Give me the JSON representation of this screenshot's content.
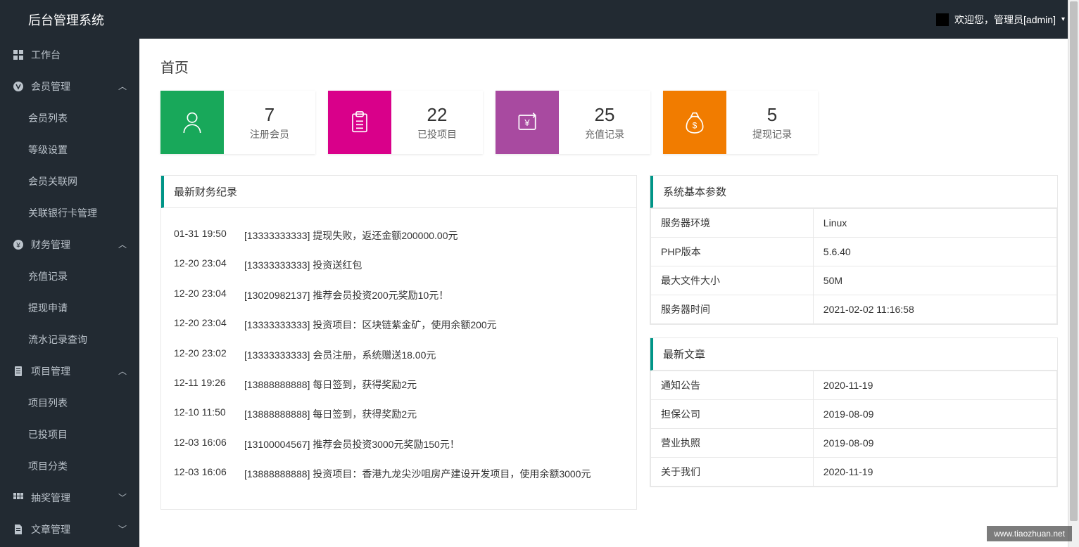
{
  "header": {
    "title": "后台管理系统",
    "welcome": "欢迎您，管理员[admin]"
  },
  "sidebar": {
    "items": [
      {
        "label": "工作台",
        "icon": "grid",
        "expandable": false
      },
      {
        "label": "会员管理",
        "icon": "circle-v",
        "expandable": true,
        "expanded": true,
        "children": [
          "会员列表",
          "等级设置",
          "会员关联网",
          "关联银行卡管理"
        ]
      },
      {
        "label": "财务管理",
        "icon": "circle-y",
        "expandable": true,
        "expanded": true,
        "children": [
          "充值记录",
          "提现申请",
          "流水记录查询"
        ]
      },
      {
        "label": "项目管理",
        "icon": "doc",
        "expandable": true,
        "expanded": true,
        "children": [
          "项目列表",
          "已投项目",
          "项目分类"
        ]
      },
      {
        "label": "抽奖管理",
        "icon": "grid2",
        "expandable": true,
        "expanded": false
      },
      {
        "label": "文章管理",
        "icon": "page",
        "expandable": true,
        "expanded": false
      }
    ]
  },
  "page": {
    "title": "首页"
  },
  "stats": [
    {
      "value": "7",
      "label": "注册会员",
      "color": "green",
      "icon": "user"
    },
    {
      "value": "22",
      "label": "已投项目",
      "color": "pink",
      "icon": "clipboard"
    },
    {
      "value": "25",
      "label": "充值记录",
      "color": "purple",
      "icon": "money-in"
    },
    {
      "value": "5",
      "label": "提现记录",
      "color": "orange",
      "icon": "money-bag"
    }
  ],
  "finance": {
    "title": "最新财务纪录",
    "rows": [
      {
        "time": "01-31 19:50",
        "text": "[13333333333] 提现失败，返还金额200000.00元"
      },
      {
        "time": "12-20 23:04",
        "text": "[13333333333] 投资送红包"
      },
      {
        "time": "12-20 23:04",
        "text": "[13020982137] 推荐会员投资200元奖励10元！"
      },
      {
        "time": "12-20 23:04",
        "text": "[13333333333] 投资项目：区块链紫金矿，使用余额200元"
      },
      {
        "time": "12-20 23:02",
        "text": "[13333333333] 会员注册，系统赠送18.00元"
      },
      {
        "time": "12-11 19:26",
        "text": "[13888888888] 每日签到，获得奖励2元"
      },
      {
        "time": "12-10 11:50",
        "text": "[13888888888] 每日签到，获得奖励2元"
      },
      {
        "time": "12-03 16:06",
        "text": "[13100004567] 推荐会员投资3000元奖励150元！"
      },
      {
        "time": "12-03 16:06",
        "text": "[13888888888] 投资项目：香港九龙尖沙咀房产建设开发项目，使用余额3000元"
      }
    ]
  },
  "sysinfo": {
    "title": "系统基本参数",
    "rows": [
      {
        "k": "服务器环境",
        "v": "Linux"
      },
      {
        "k": "PHP版本",
        "v": "5.6.40"
      },
      {
        "k": "最大文件大小",
        "v": "50M"
      },
      {
        "k": "服务器时间",
        "v": "2021-02-02 11:16:58"
      }
    ]
  },
  "articles": {
    "title": "最新文章",
    "rows": [
      {
        "k": "通知公告",
        "v": "2020-11-19"
      },
      {
        "k": "担保公司",
        "v": "2019-08-09"
      },
      {
        "k": "营业执照",
        "v": "2019-08-09"
      },
      {
        "k": "关于我们",
        "v": "2020-11-19"
      }
    ]
  },
  "watermark": "www.tiaozhuan.net"
}
